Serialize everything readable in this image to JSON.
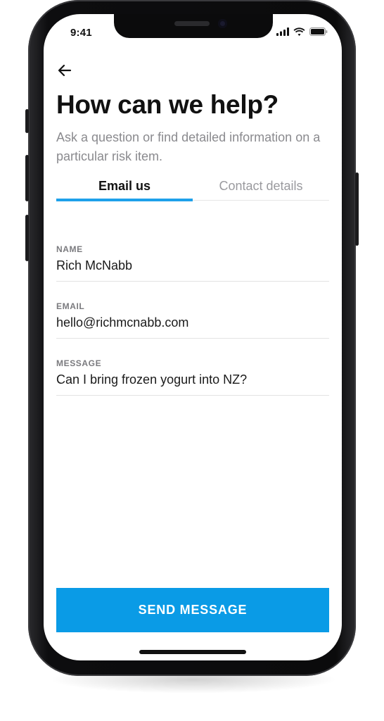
{
  "status_bar": {
    "time": "9:41",
    "signal_icon": "cellular-signal-icon",
    "wifi_icon": "wifi-icon",
    "battery_icon": "battery-icon"
  },
  "header": {
    "back_icon": "arrow-left-icon",
    "title": "How can we help?",
    "subtitle": "Ask a question or find detailed information on a particular risk item."
  },
  "tabs": [
    {
      "label": "Email us",
      "active": true
    },
    {
      "label": "Contact details",
      "active": false
    }
  ],
  "form": {
    "name": {
      "label": "NAME",
      "value": "Rich McNabb"
    },
    "email": {
      "label": "EMAIL",
      "value": "hello@richmcnabb.com"
    },
    "message": {
      "label": "MESSAGE",
      "value": "Can I bring frozen yogurt into NZ?"
    }
  },
  "actions": {
    "send_label": "SEND MESSAGE"
  },
  "colors": {
    "accent": "#1ea1ea",
    "button": "#0a9be6",
    "title": "#111111",
    "muted": "#8a8a8e"
  }
}
